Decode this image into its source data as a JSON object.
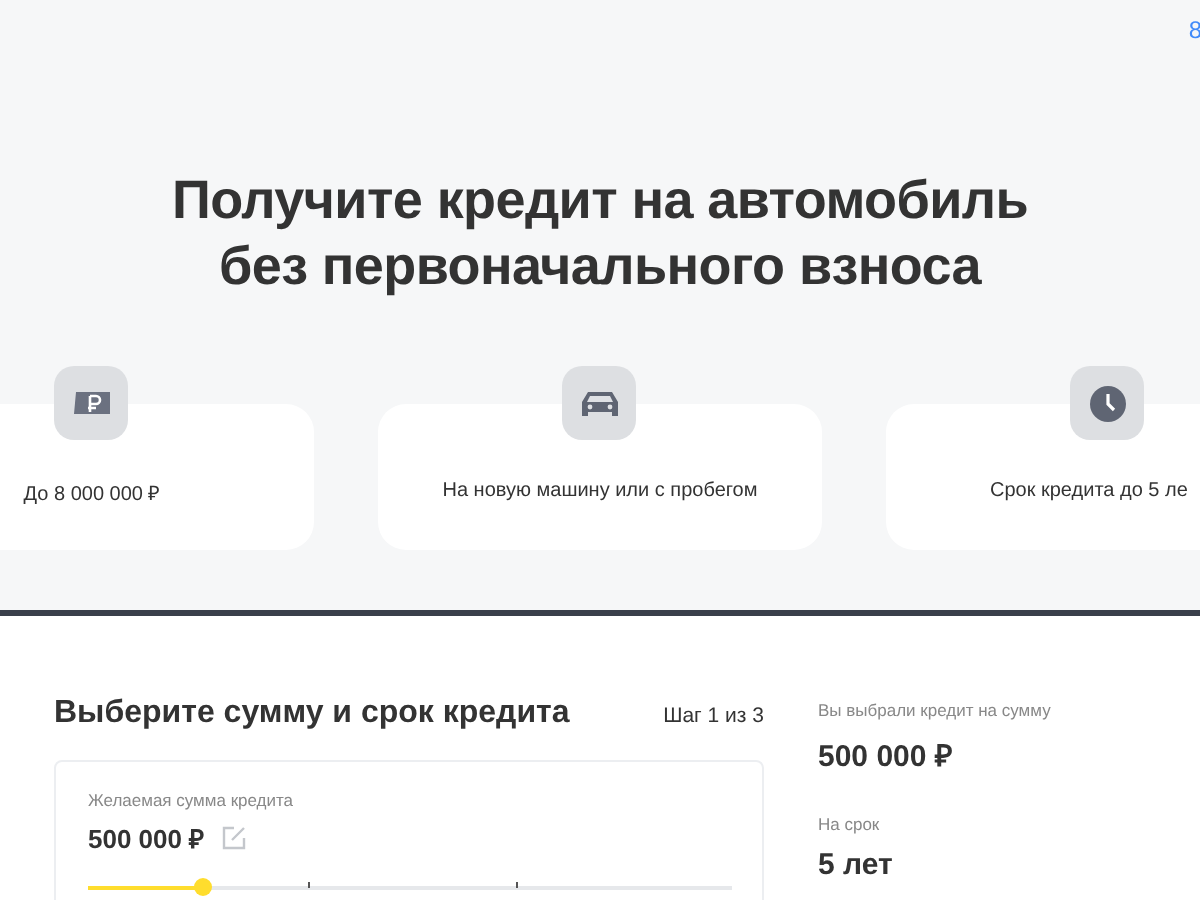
{
  "header": {
    "phone": "8"
  },
  "hero": {
    "title_lines": [
      "Получите кредит на автомобиль",
      "без первоначального взноса"
    ]
  },
  "features": [
    {
      "kind": "money",
      "text": "До 8 000 000 ₽"
    },
    {
      "kind": "car",
      "text": "На новую машину или с пробегом"
    },
    {
      "kind": "clock",
      "text": "Срок кредита до 5 ле"
    }
  ],
  "calculator": {
    "title": "Выберите сумму и срок кредита",
    "step": "Шаг 1 из 3",
    "amount": {
      "label": "Желаемая сумма кредита",
      "value": "500 000 ₽",
      "level": 0.18
    }
  },
  "summary": {
    "amount_label": "Вы выбрали кредит на сумму",
    "amount": "500 000 ₽",
    "term_label": "На срок",
    "term": "5 лет"
  }
}
